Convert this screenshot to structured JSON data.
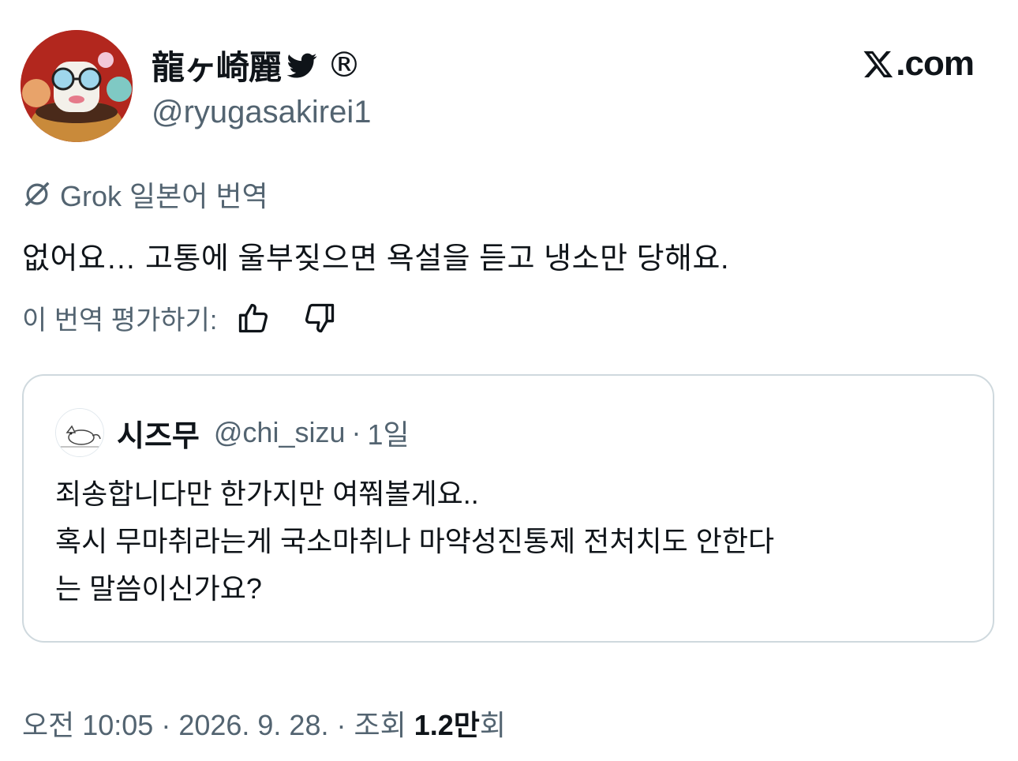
{
  "author": {
    "display_name": "龍ヶ崎麗",
    "handle": "@ryugasakirei1",
    "badge_icon": "twitter-bird-icon",
    "registered_icon": "registered-mark-icon",
    "registered_mark": "®"
  },
  "brand": {
    "domain": ".com",
    "logo_icon": "x-logo-icon"
  },
  "translation": {
    "label": "Grok 일본어 번역",
    "text": "없어요… 고통에 울부짖으면 욕설을 듣고 냉소만 당해요.",
    "rate_label": "이 번역 평가하기:"
  },
  "quoted_tweet": {
    "display_name": "시즈무",
    "handle": "@chi_sizu",
    "separator": "·",
    "time": "1일",
    "lines": [
      "죄송합니다만 한가지만 여쭤볼게요..",
      "혹시 무마취라는게 국소마취나 마약성진통제 전처치도 안한다",
      "는 말씀이신가요?"
    ]
  },
  "meta": {
    "time": "오전 10:05 · 2026. 9. 28. · 조회 ",
    "views": "1.2만",
    "views_suffix": "회"
  },
  "colors": {
    "text": "#0f1419",
    "secondary": "#536471",
    "border": "#cfd9de"
  }
}
